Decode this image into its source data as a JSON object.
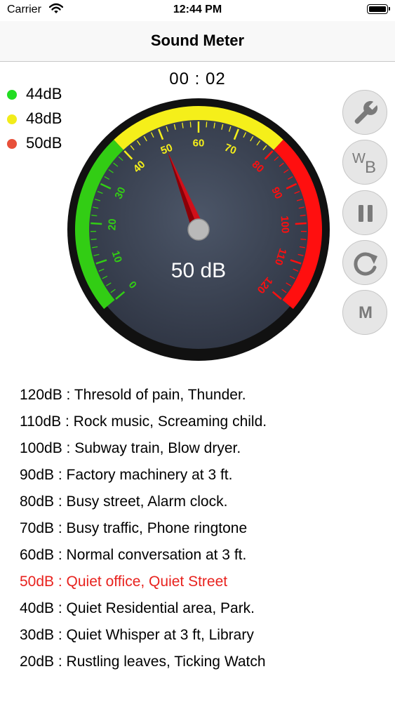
{
  "status_bar": {
    "carrier": "Carrier",
    "time": "12:44 PM"
  },
  "nav": {
    "title": "Sound Meter"
  },
  "timer": "00 : 02",
  "legend": [
    {
      "label": "44dB",
      "color": "#22dd22"
    },
    {
      "label": "48dB",
      "color": "#f2ec1a"
    },
    {
      "label": "50dB",
      "color": "#e8503a"
    }
  ],
  "gauge": {
    "reading": "50 dB",
    "value_db": 50,
    "min": 0,
    "max": 120,
    "tick_labels": [
      "0",
      "10",
      "20",
      "30",
      "40",
      "50",
      "60",
      "70",
      "80",
      "90",
      "100",
      "110",
      "120"
    ],
    "colors": {
      "green": "#32cd14",
      "yellow": "#f5ef1a",
      "red": "#ff0f0f",
      "face": "#3a4150",
      "needle": "#d0101a"
    }
  },
  "side_buttons": {
    "settings": {
      "icon": "wrench-icon"
    },
    "white_balance": {
      "w": "W",
      "b": "B"
    },
    "pause": {
      "icon": "pause-icon"
    },
    "reset": {
      "icon": "refresh-icon"
    },
    "mode": {
      "label": "M"
    }
  },
  "reference": [
    "120dB : Thresold of pain, Thunder.",
    "110dB : Rock music, Screaming child.",
    "100dB : Subway train, Blow dryer.",
    "90dB : Factory machinery at 3 ft.",
    "80dB : Busy street, Alarm clock.",
    "70dB : Busy traffic, Phone ringtone",
    "60dB : Normal conversation at 3 ft.",
    "50dB : Quiet office, Quiet Street",
    "40dB : Quiet Residential area, Park.",
    "30dB : Quiet Whisper at 3 ft, Library",
    "20dB : Rustling leaves, Ticking Watch"
  ],
  "reference_active_index": 7,
  "colors": {
    "active_text": "#e8221e"
  }
}
